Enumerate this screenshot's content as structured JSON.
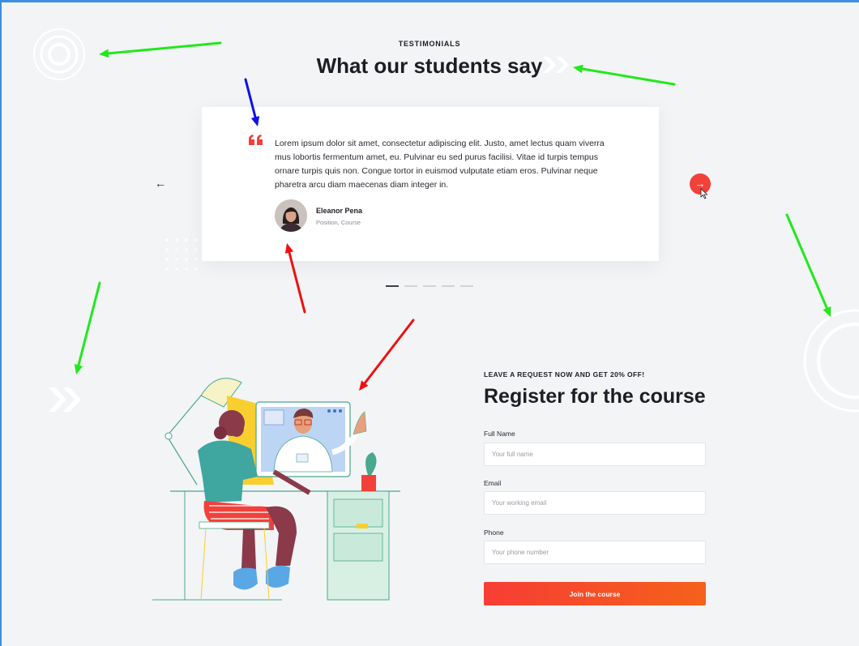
{
  "testimonials": {
    "eyebrow": "TESTIMONIALS",
    "title": "What our students say",
    "quote": "Lorem ipsum dolor sit amet, consectetur adipiscing elit. Justo, amet lectus quam viverra mus lobortis fermentum amet, eu. Pulvinar eu sed purus facilisi. Vitae id turpis tempus ornare turpis quis non. Congue tortor in euismod vulputate etiam eros. Pulvinar neque pharetra arcu diam maecenas diam integer in.",
    "author_name": "Eleanor Pena",
    "author_role": "Position, Course",
    "prev_label": "←",
    "next_label": "→",
    "slides_total": 5,
    "active_slide": 1
  },
  "register": {
    "eyebrow": "LEAVE A REQUEST NOW AND GET 20% OFF!",
    "title": "Register for the course",
    "fields": [
      {
        "label": "Full Name",
        "placeholder": "Your full name",
        "value": ""
      },
      {
        "label": "Email",
        "placeholder": "Your working email",
        "value": ""
      },
      {
        "label": "Phone",
        "placeholder": "Your phone number",
        "value": ""
      }
    ],
    "submit_label": "Join the course"
  },
  "colors": {
    "accent": "#f1413a",
    "annotation_green": "#22e81c",
    "annotation_red": "#ee1111",
    "annotation_blue": "#1010e8",
    "page_background": "#f2f4f6"
  }
}
